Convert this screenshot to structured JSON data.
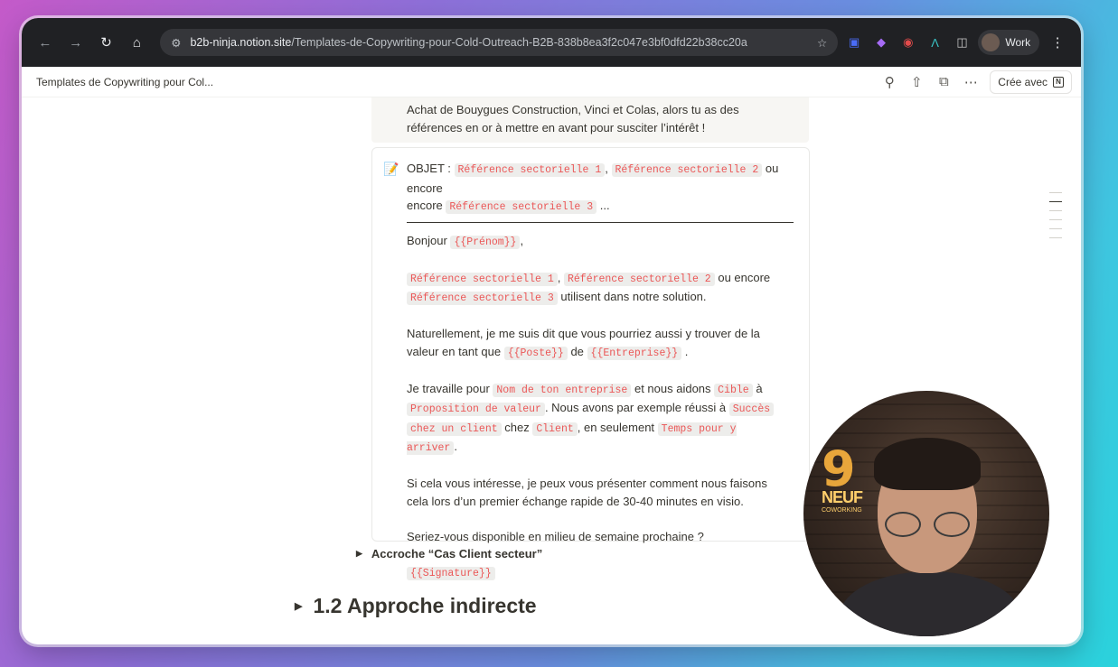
{
  "browser": {
    "url_host": "b2b-ninja.notion.site",
    "url_path": "/Templates-de-Copywriting-pour-Cold-Outreach-B2B-838b8ea3f2c047e3bf0dfd22b38cc20a",
    "profile_label": "Work"
  },
  "notion_bar": {
    "title": "Templates de Copywriting pour Col...",
    "cree_label": "Crée avec"
  },
  "top_callout": {
    "line1": "Achat de Bouygues Construction, Vinci et Colas, alors tu as des",
    "line2": "références en or à mettre en avant pour susciter l’intérêt !"
  },
  "email": {
    "objet_label": "OBJET :",
    "ref1": "Référence sectorielle 1",
    "ref2": "Référence sectorielle 2",
    "ref3": "Référence sectorielle 3",
    "comma": ",",
    "ou_encore": "ou encore",
    "ellipsis": "...",
    "bonjour": "Bonjour",
    "prenom": "{{Prénom}}",
    "utilisent": "utilisent dans notre solution.",
    "p3_a": "Naturellement, je me suis dit que vous pourriez aussi y trouver de la",
    "p3_b": "valeur en tant que",
    "poste": "{{Poste}}",
    "de": "de",
    "entreprise": "{{Entreprise}}",
    "dot": ".",
    "je_travaille": "Je travaille pour",
    "nom_entreprise": "Nom de ton entreprise",
    "et_nous_aidons": "et nous aidons",
    "cible": "Cible",
    "a": "à",
    "proposition": "Proposition de valeur",
    "nous_avons": ". Nous avons par exemple réussi à",
    "succes": "Succès",
    "chez_un_client": "chez un client",
    "chez": "chez",
    "client": "Client",
    "en_seulement": ", en seulement",
    "temps": "Temps pour y arriver",
    "p5_a": "Si cela vous intéresse, je peux vous présenter comment nous faisons",
    "p5_b": "cela lors d’un premier échange rapide de 30-40 minutes en visio.",
    "p6": "Seriez-vous disponible en milieu de semaine prochaine ?",
    "signature": "{{Signature}}"
  },
  "toggle": {
    "label": "Accroche “Cas Client secteur”"
  },
  "heading": {
    "label": "1.2 Approche indirecte"
  },
  "webcam": {
    "sign_big": "9",
    "sign_neuf": "NEUF",
    "sign_coworking": "COWORKING"
  }
}
